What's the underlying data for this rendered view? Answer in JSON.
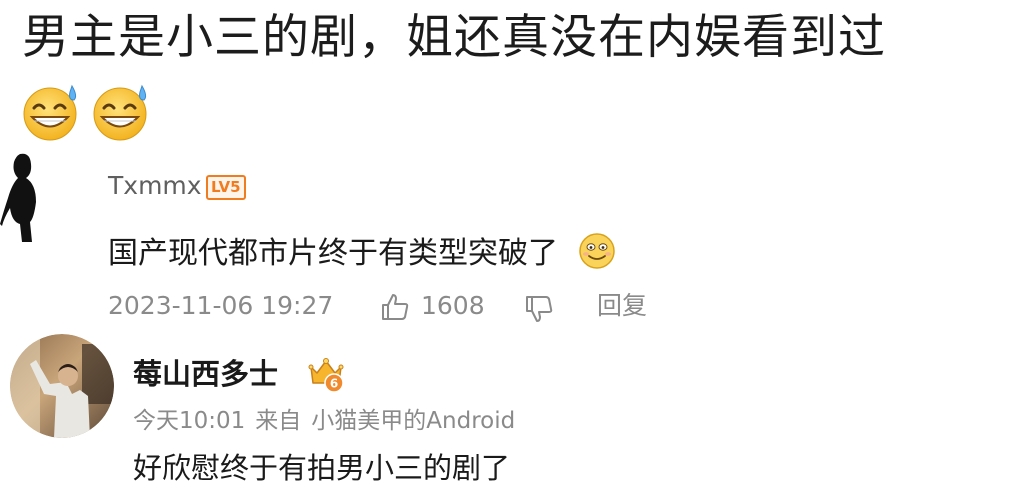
{
  "post": {
    "headline": "男主是小三的剧，姐还真没在内娱看到过",
    "emojis": [
      "grinning-sweat-icon",
      "grinning-sweat-icon"
    ]
  },
  "comments": [
    {
      "username": "Txmmx",
      "level_badge": "LV5",
      "text": "国产现代都市片终于有类型突破了",
      "trailing_emoji": "smile-icon",
      "timestamp": "2023-11-06 19:27",
      "like_count": "1608",
      "reply_label": "回复"
    },
    {
      "username": "莓山西多士",
      "badge_icon": "crown-medal-icon",
      "badge_number": "6",
      "time": "今天10:01",
      "source_label": "来自",
      "source_name": "小猫美甲的Android",
      "text": "好欣慰终于有拍男小三的剧了"
    }
  ],
  "colors": {
    "text_primary": "#1a1a1a",
    "text_secondary": "#8a8a8a",
    "username_gray": "#5f5f5f",
    "level_orange": "#f07c21",
    "emoji_yellow": "#f5c12f"
  }
}
